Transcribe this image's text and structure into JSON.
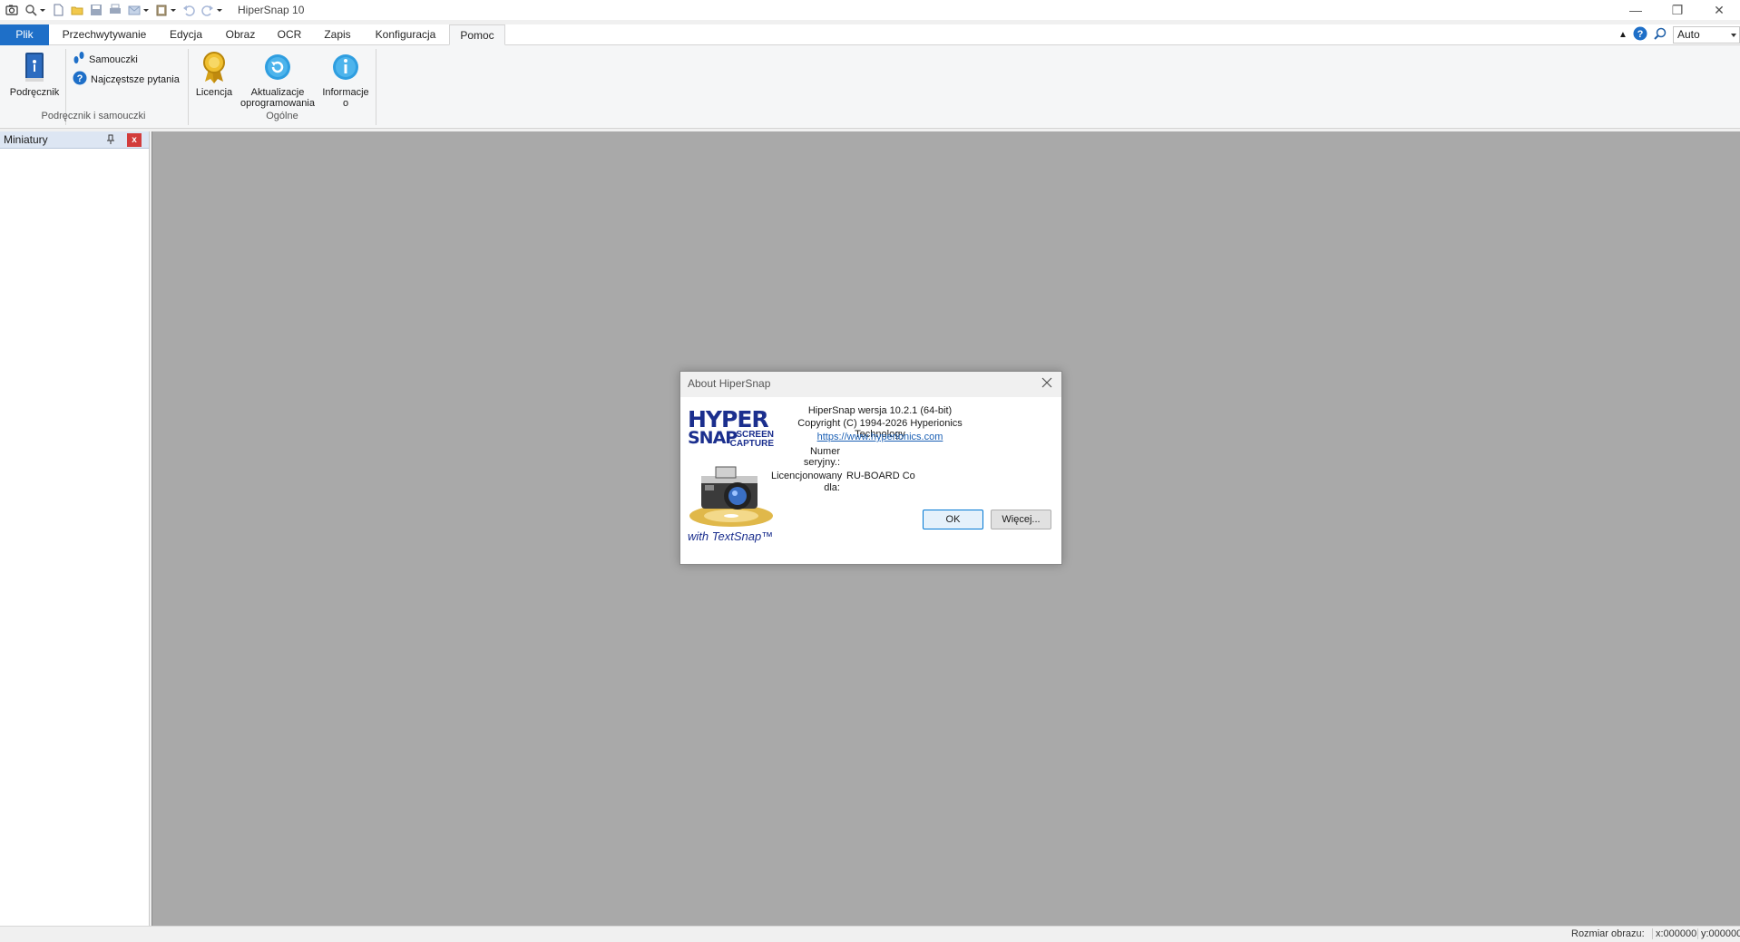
{
  "window": {
    "title": "HiperSnap 10",
    "controls": {
      "minimize": "—",
      "restore": "❐",
      "close": "✕"
    }
  },
  "quick_access": {
    "icons": [
      "camera-icon",
      "magnifier-icon",
      "new-icon",
      "open-icon",
      "save-icon",
      "print-icon",
      "send-icon",
      "clipboard-icon",
      "undo-icon",
      "redo-icon",
      "customize-icon"
    ]
  },
  "tabs": {
    "file": "Plik",
    "items": [
      "Przechwytywanie",
      "Edycja",
      "Obraz",
      "OCR",
      "Zapis",
      "Konfiguracja",
      "Pomoc"
    ],
    "active": "Pomoc",
    "zoom_value": "Auto"
  },
  "ribbon": {
    "manual": "Podręcznik",
    "tutorials": "Samouczki",
    "faq": "Najczęstsze pytania",
    "group1_label": "Podręcznik i samouczki",
    "license": "Licencja",
    "updates_line1": "Aktualizacje",
    "updates_line2": "oprogramowania",
    "about_line1": "Informacje",
    "about_line2": "o",
    "group2_label": "Ogólne"
  },
  "pane": {
    "title": "Miniatury",
    "close": "x"
  },
  "dialog": {
    "title": "About HiperSnap",
    "version": "HiperSnap wersja 10.2.1 (64-bit)",
    "copyright": "Copyright (C) 1994-2026 Hyperionics Technology",
    "link": "https://www.hyperionics.com",
    "serial_label": "Numer seryjny.:",
    "serial_value": "",
    "licensed_label_1": "Licencjonowany",
    "licensed_label_2": "dla:",
    "licensed_value": "RU-BOARD Co",
    "ok": "OK",
    "more": "Więcej...",
    "logo": {
      "hyper": "HYPER",
      "snap": "SNAP",
      "screen": "SCREEN",
      "capture": "CAPTURE",
      "textsnap": "with TextSnap™"
    }
  },
  "status": {
    "image_size": "Rozmiar obrazu:",
    "x": "x:000000",
    "y": "y:000000"
  },
  "colors": {
    "file_tab": "#1e6fc8",
    "workspace": "#a9a9a9",
    "accent_button": "#0078d4",
    "logo_blue": "#1b2f8e"
  }
}
